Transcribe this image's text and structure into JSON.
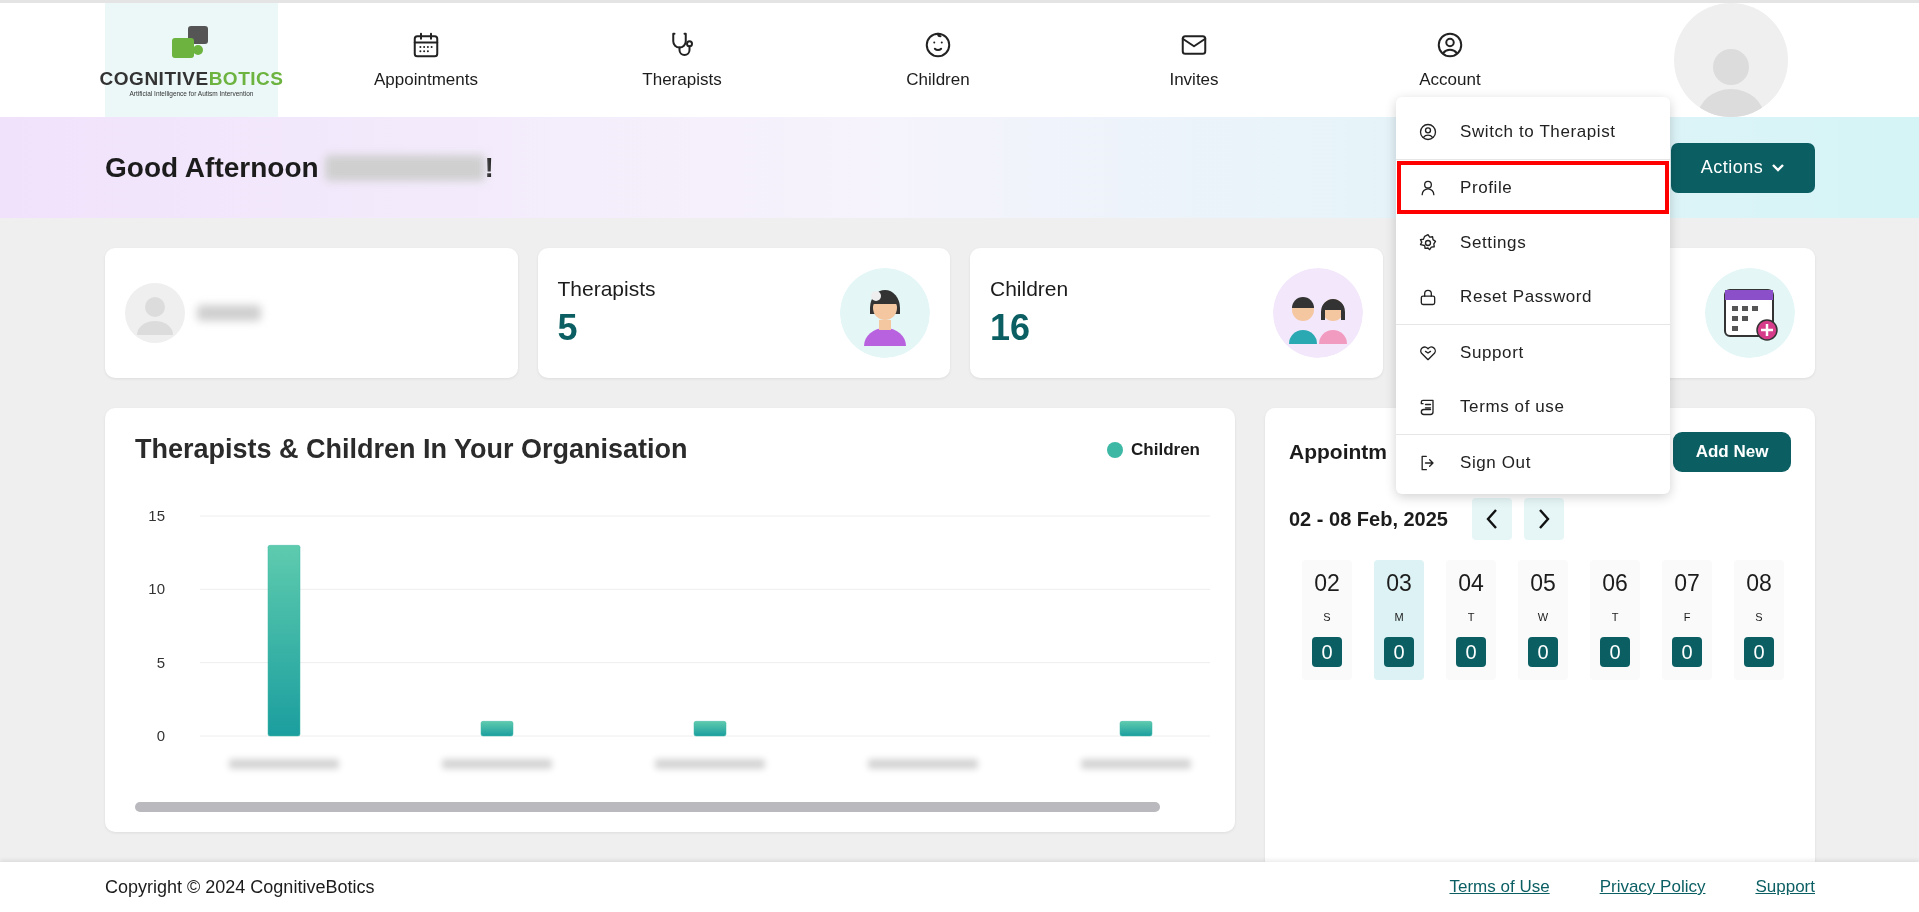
{
  "nav": {
    "logo": {
      "name": "COGNITIVE",
      "name_accent": "BOTICS",
      "tagline": "Artificial Intelligence for Autism Intervention"
    },
    "items": [
      {
        "label": "Appointments"
      },
      {
        "label": "Therapists"
      },
      {
        "label": "Children"
      },
      {
        "label": "Invites"
      },
      {
        "label": "Account"
      }
    ]
  },
  "banner": {
    "greeting": "Good Afternoon",
    "greeting_end": "!",
    "actions_button": "Actions"
  },
  "stat_cards": [
    {
      "kind": "profile"
    },
    {
      "kind": "count",
      "label": "Therapists",
      "value": "5"
    },
    {
      "kind": "count",
      "label": "Children",
      "value": "16"
    },
    {
      "kind": "covered"
    }
  ],
  "chart_card": {
    "title": "Therapists & Children In Your Organisation",
    "chart_data": {
      "type": "bar",
      "series": [
        {
          "name": "Children",
          "color": "#3cb8a5",
          "values": [
            13,
            1,
            1,
            0,
            1
          ]
        }
      ],
      "ylim": [
        0,
        15
      ],
      "yticks": [
        0,
        5,
        10,
        15
      ]
    }
  },
  "appointments": {
    "title": "Appointm",
    "add_button": "Add New",
    "range": "02 - 08 Feb, 2025",
    "days": [
      {
        "day": "02",
        "weekday": "S",
        "count": "0",
        "selected": false
      },
      {
        "day": "03",
        "weekday": "M",
        "count": "0",
        "selected": true
      },
      {
        "day": "04",
        "weekday": "T",
        "count": "0",
        "selected": false
      },
      {
        "day": "05",
        "weekday": "W",
        "count": "0",
        "selected": false
      },
      {
        "day": "06",
        "weekday": "T",
        "count": "0",
        "selected": false
      },
      {
        "day": "07",
        "weekday": "F",
        "count": "0",
        "selected": false
      },
      {
        "day": "08",
        "weekday": "S",
        "count": "0",
        "selected": false
      }
    ]
  },
  "account_menu": [
    {
      "label": "Switch to Therapist",
      "selected": false,
      "divider_after": true
    },
    {
      "label": "Profile",
      "selected": true,
      "divider_after": false
    },
    {
      "label": "Settings",
      "selected": false,
      "divider_after": false
    },
    {
      "label": "Reset Password",
      "selected": false,
      "divider_after": true
    },
    {
      "label": "Support",
      "selected": false,
      "divider_after": false
    },
    {
      "label": "Terms of use",
      "selected": false,
      "divider_after": true
    },
    {
      "label": "Sign Out",
      "selected": false,
      "divider_after": false
    }
  ],
  "footer": {
    "copyright": "Copyright © 2024 CognitiveBotics",
    "links": [
      "Terms of Use",
      "Privacy Policy",
      "Support"
    ]
  }
}
